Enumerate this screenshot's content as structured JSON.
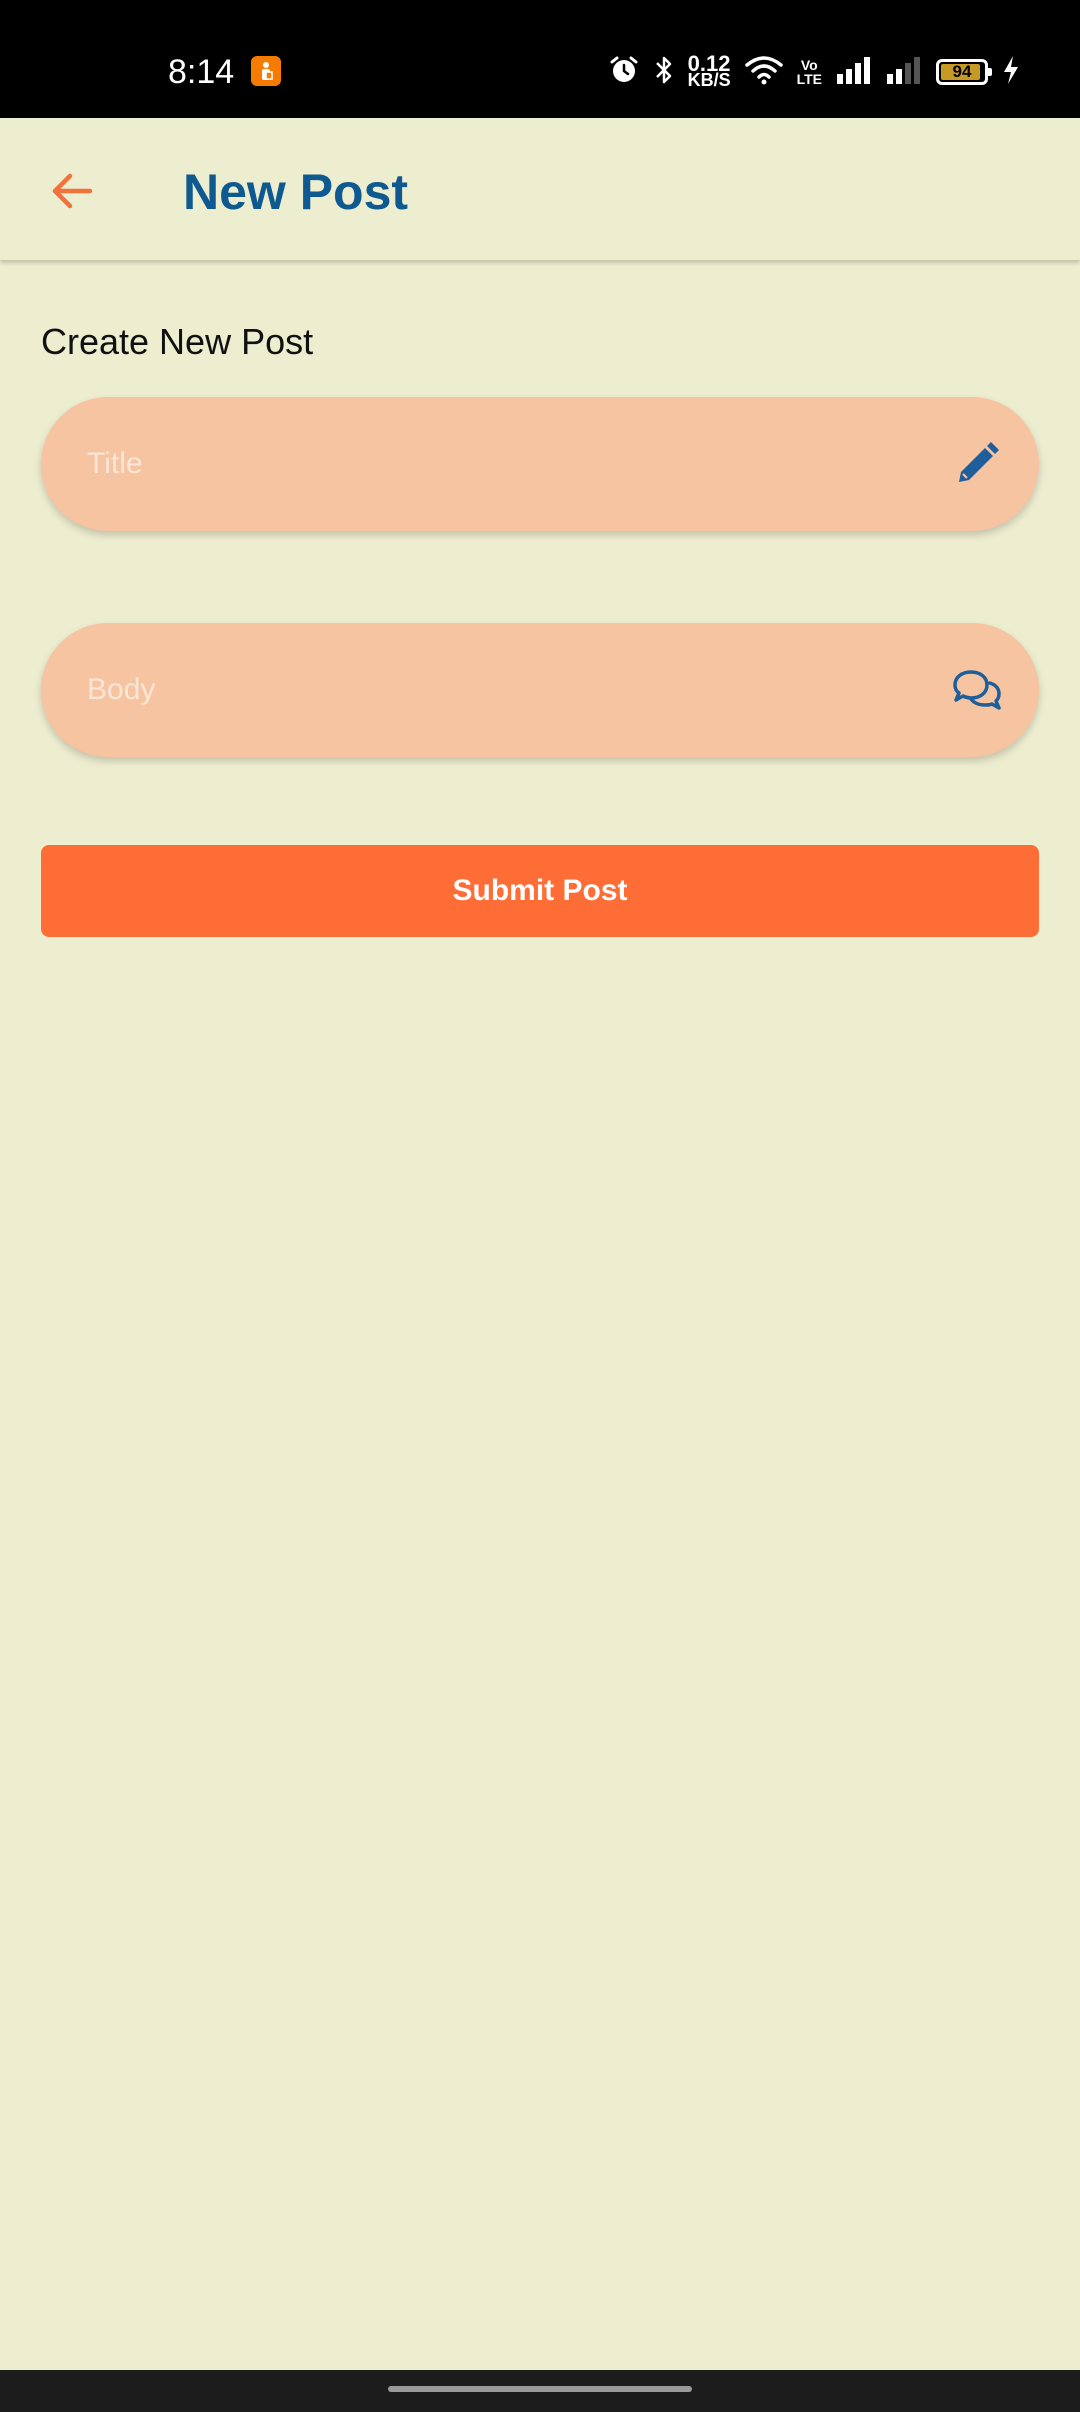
{
  "status_bar": {
    "time": "8:14",
    "net_speed_value": "0.12",
    "net_speed_unit": "KB/S",
    "volte_top": "Vo",
    "volte_bottom": "LTE",
    "battery_level": "94",
    "battery_fraction": 0.94,
    "icons": [
      "app-notification-icon",
      "alarm-icon",
      "bluetooth-icon",
      "wifi-icon",
      "signal-icon",
      "signal-weak-icon",
      "battery-icon",
      "charging-icon"
    ]
  },
  "app_bar": {
    "title": "New Post",
    "back_icon": "arrow-left-icon"
  },
  "form": {
    "heading": "Create New Post",
    "title_field": {
      "placeholder": "Title",
      "value": "",
      "icon": "pencil-icon"
    },
    "body_field": {
      "placeholder": "Body",
      "value": "",
      "icon": "chat-bubbles-icon"
    },
    "submit_label": "Submit Post"
  },
  "colors": {
    "background": "#EDEDD0",
    "title_text": "#0E5A90",
    "accent": "#FF6D37",
    "field_fill": "#F6C4A0",
    "icon_blue": "#1E5E9A",
    "back_arrow": "#F0733C"
  }
}
